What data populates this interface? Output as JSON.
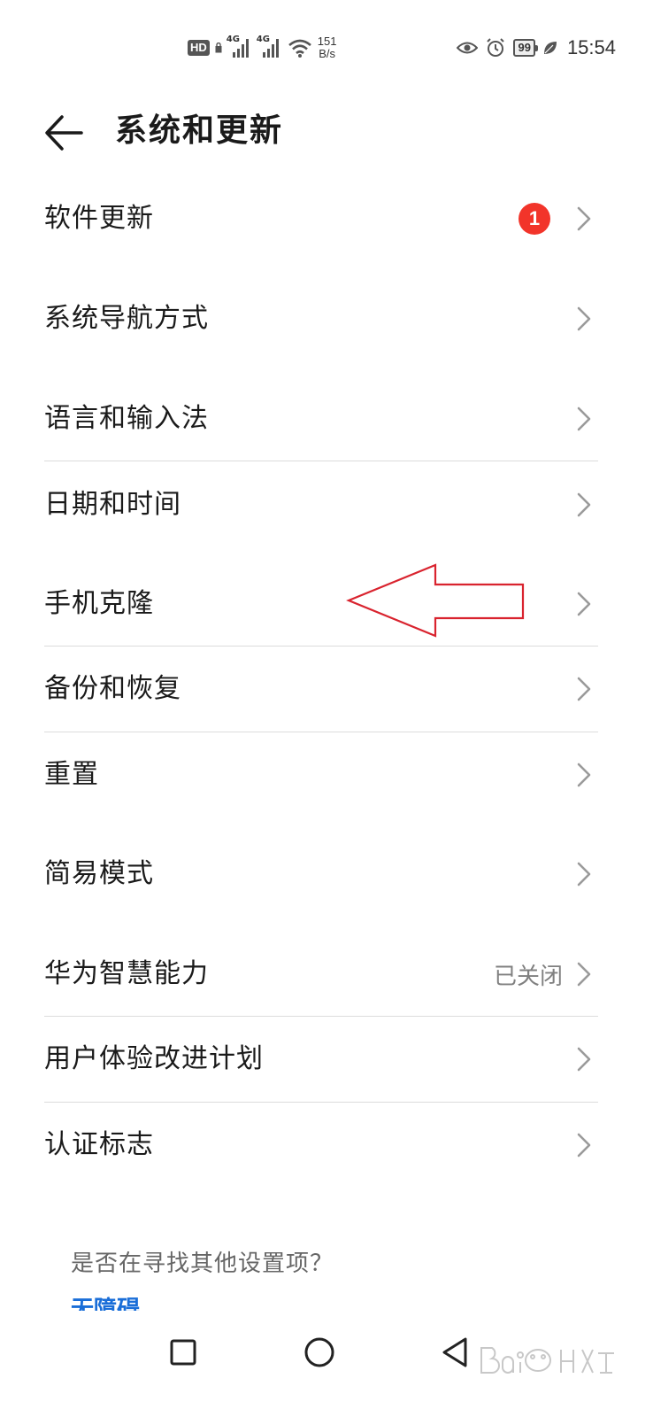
{
  "status_bar": {
    "hd_label": "HD",
    "sim1_network": "4G",
    "sim2_network": "4G",
    "speed_value": "151",
    "speed_unit": "B/s",
    "battery": "99",
    "time": "15:54"
  },
  "header": {
    "title": "系统和更新"
  },
  "items": [
    {
      "label": "软件更新",
      "badge": "1"
    },
    {
      "label": "系统导航方式"
    },
    {
      "label": "语言和输入法"
    },
    {
      "label": "日期和时间"
    },
    {
      "label": "手机克隆"
    },
    {
      "label": "备份和恢复"
    },
    {
      "label": "重置"
    },
    {
      "label": "简易模式"
    },
    {
      "label": "华为智慧能力",
      "value": "已关闭"
    },
    {
      "label": "用户体验改进计划"
    },
    {
      "label": "认证标志"
    }
  ],
  "footer": {
    "question": "是否在寻找其他设置项？",
    "link": "无障碍"
  },
  "colors": {
    "badge": "#f2342a",
    "link": "#1a6ed8",
    "annotation_arrow": "#d9232e"
  }
}
